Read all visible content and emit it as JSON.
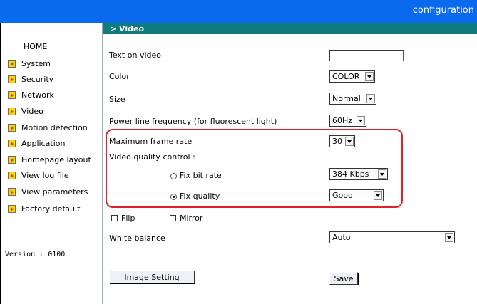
{
  "header": {
    "title": "configuration"
  },
  "sidebar": {
    "home": "HOME",
    "items": [
      {
        "label": "System"
      },
      {
        "label": "Security"
      },
      {
        "label": "Network"
      },
      {
        "label": "Video"
      },
      {
        "label": "Motion detection"
      },
      {
        "label": "Application"
      },
      {
        "label": "Homepage layout"
      },
      {
        "label": "View log file"
      },
      {
        "label": "View parameters"
      },
      {
        "label": "Factory default"
      }
    ],
    "active_item": "Video",
    "version": "Version : 0100"
  },
  "main": {
    "section_title": "> Video",
    "text_on_video": {
      "label": "Text on video",
      "value": ""
    },
    "color": {
      "label": "Color",
      "value": "COLOR"
    },
    "size": {
      "label": "Size",
      "value": "Normal"
    },
    "power_line": {
      "label": "Power line frequency (for fluorescent light)",
      "value": "60Hz"
    },
    "max_frame_rate": {
      "label": "Maximum frame rate",
      "value": "30"
    },
    "quality_control": {
      "label": "Video quality control :"
    },
    "fix_bit_rate": {
      "label": "Fix bit rate",
      "value": "384 Kbps",
      "selected": false
    },
    "fix_quality": {
      "label": "Fix quality",
      "value": "Good",
      "selected": true
    },
    "flip": {
      "label": "Flip",
      "checked": false
    },
    "mirror": {
      "label": "Mirror",
      "checked": false
    },
    "white_balance": {
      "label": "White balance",
      "value": "Auto"
    },
    "image_setting_button": "Image Setting",
    "save_button": "Save"
  },
  "colors": {
    "topbar": "#0a6aee",
    "section_header": "#0f7b7b",
    "highlight_border": "#e0202a",
    "nav_arrow": "#ffd200"
  }
}
